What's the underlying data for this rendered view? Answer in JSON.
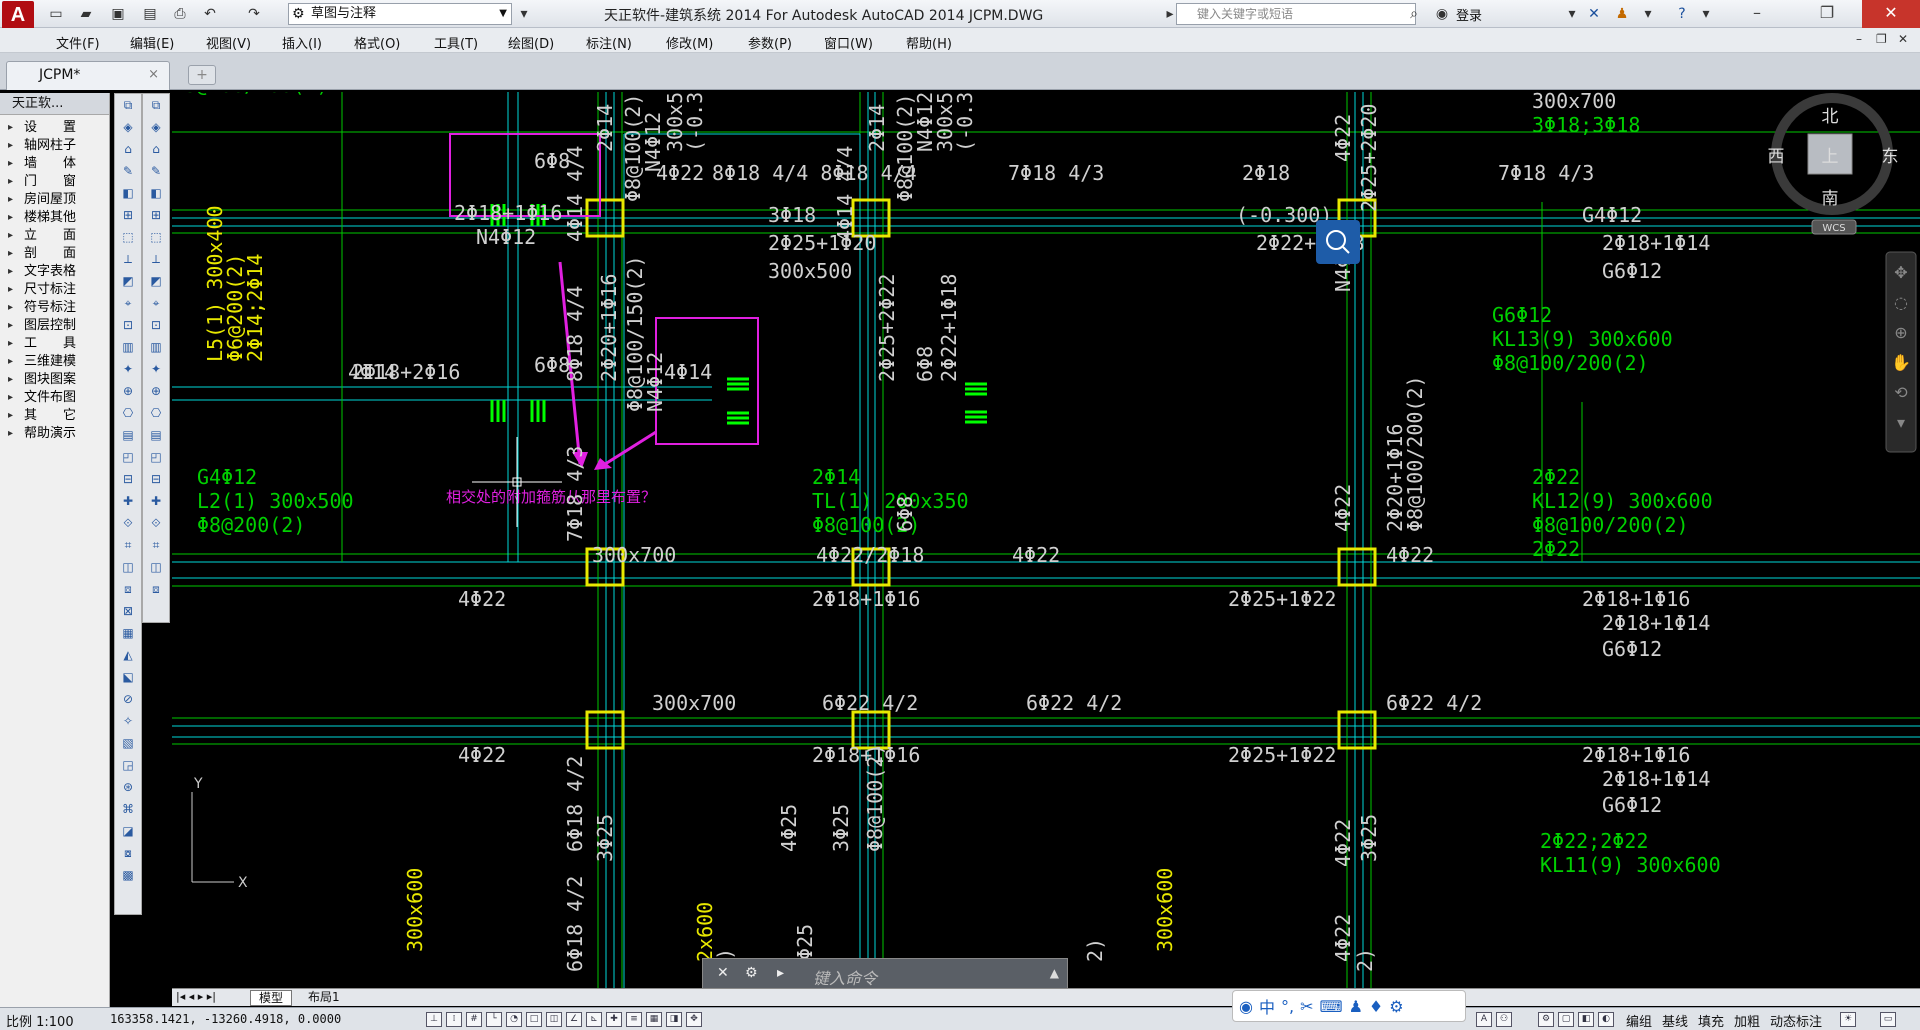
{
  "app": {
    "logo": "A",
    "title": "天正软件-建筑系统 2014  For Autodesk AutoCAD 2014    JCPM.DWG",
    "workspace": "草图与注释",
    "search_placeholder": "键入关键字或短语",
    "login": "登录"
  },
  "menu": [
    "文件(F)",
    "编辑(E)",
    "视图(V)",
    "插入(I)",
    "格式(O)",
    "工具(T)",
    "绘图(D)",
    "标注(N)",
    "修改(M)",
    "参数(P)",
    "窗口(W)",
    "帮助(H)"
  ],
  "tab": {
    "label": "JCPM*",
    "close": "×",
    "new": "+"
  },
  "panel": {
    "title": "天正软...",
    "items": [
      "设　　置",
      "轴网柱子",
      "墙　　体",
      "门　　窗",
      "房间屋顶",
      "楼梯其他",
      "立　　面",
      "剖　　面",
      "文字表格",
      "尺寸标注",
      "符号标注",
      "图层控制",
      "工　　具",
      "三维建模",
      "图块图案",
      "文件布图",
      "其　　它",
      "帮助演示"
    ]
  },
  "viewcube": {
    "north": "北",
    "south": "南",
    "east": "东",
    "west": "西",
    "top": "上",
    "wcs": "WCS"
  },
  "drawing": {
    "magenta_note": "相交处的附加箍筋从那里布置？",
    "ucs_x": "X",
    "ucs_y": "Y",
    "labels": [
      {
        "t": "6Φ8",
        "c": "w"
      },
      {
        "t": "2Φ18+1Φ16",
        "c": "w"
      },
      {
        "t": "N4Φ12",
        "c": "w"
      },
      {
        "t": "6Φ8",
        "c": "w"
      },
      {
        "t": "4Φ14",
        "c": "w"
      },
      {
        "t": "2Φ18+2Φ16",
        "c": "w"
      },
      {
        "t": "4Φ14",
        "c": "w"
      },
      {
        "t": "4Φ22",
        "c": "w"
      },
      {
        "t": "8Φ18  4/4  8Φ18  4/4",
        "c": "w"
      },
      {
        "t": "7Φ18  4/3",
        "c": "w"
      },
      {
        "t": "2Φ18",
        "c": "w"
      },
      {
        "t": "7Φ18  4/3",
        "c": "w"
      },
      {
        "t": "3Φ18",
        "c": "w"
      },
      {
        "t": "2Φ25+1Φ20",
        "c": "w"
      },
      {
        "t": "300x500",
        "c": "w"
      },
      {
        "t": "(-0.300)",
        "c": "w"
      },
      {
        "t": "2Φ22+1Φ18",
        "c": "w"
      },
      {
        "t": "G4Φ12",
        "c": "w"
      },
      {
        "t": "2Φ18+1Φ14",
        "c": "w"
      },
      {
        "t": "G6Φ12",
        "c": "w"
      },
      {
        "t": "300x700",
        "c": "w"
      },
      {
        "t": "4Φ22/2Φ18",
        "c": "w"
      },
      {
        "t": "4Φ22",
        "c": "w"
      },
      {
        "t": "4Φ22",
        "c": "w"
      },
      {
        "t": "4Φ22",
        "c": "w"
      },
      {
        "t": "2Φ18+1Φ16",
        "c": "w"
      },
      {
        "t": "2Φ25+1Φ22",
        "c": "w"
      },
      {
        "t": "2Φ18+1Φ16",
        "c": "w"
      },
      {
        "t": "2Φ18+1Φ14",
        "c": "w"
      },
      {
        "t": "G6Φ12",
        "c": "w"
      },
      {
        "t": "300x700",
        "c": "w"
      },
      {
        "t": "6Φ22  4/2",
        "c": "w"
      },
      {
        "t": "6Φ22  4/2",
        "c": "w"
      },
      {
        "t": "6Φ22  4/2",
        "c": "w"
      },
      {
        "t": "4Φ22",
        "c": "w"
      },
      {
        "t": "2Φ18+1Φ16",
        "c": "w"
      },
      {
        "t": "2Φ25+1Φ22",
        "c": "w"
      },
      {
        "t": "2Φ18+1Φ16",
        "c": "w"
      },
      {
        "t": "2Φ18+1Φ14",
        "c": "w"
      },
      {
        "t": "G6Φ12",
        "c": "w"
      },
      {
        "t": "300x700",
        "c": "w"
      },
      {
        "t": "3Φ18;3Φ18",
        "c": "g"
      },
      {
        "t": "G6Φ12",
        "c": "g"
      },
      {
        "t": "KL13(9) 300x600",
        "c": "g"
      },
      {
        "t": "Φ8@100/200(2)",
        "c": "g"
      },
      {
        "t": "2Φ22",
        "c": "g"
      },
      {
        "t": "KL12(9) 300x600",
        "c": "g"
      },
      {
        "t": "Φ8@100/200(2)",
        "c": "g"
      },
      {
        "t": "2Φ22",
        "c": "g"
      },
      {
        "t": "G4Φ12",
        "c": "g"
      },
      {
        "t": "L2(1) 300x500",
        "c": "g"
      },
      {
        "t": "Φ8@200(2)",
        "c": "g"
      },
      {
        "t": "2Φ14",
        "c": "g"
      },
      {
        "t": "TL(1) 200x350",
        "c": "g"
      },
      {
        "t": "Φ8@100(2)",
        "c": "g"
      },
      {
        "t": "2Φ22;2Φ22",
        "c": "g"
      },
      {
        "t": "KL11(9) 300x600",
        "c": "g"
      },
      {
        "t": "Φ8@100/200(2)",
        "c": "g"
      }
    ],
    "vlabels": [
      {
        "t": "4Φ14  4/4",
        "c": "w"
      },
      {
        "t": "2Φ14",
        "c": "w"
      },
      {
        "t": "Φ8@100(2)",
        "c": "w"
      },
      {
        "t": "N4Φ12",
        "c": "w"
      },
      {
        "t": "300x500",
        "c": "w"
      },
      {
        "t": "(-0.300)",
        "c": "w"
      },
      {
        "t": "4Φ14  4/4",
        "c": "w"
      },
      {
        "t": "2Φ14",
        "c": "w"
      },
      {
        "t": "Φ8@100(2)",
        "c": "w"
      },
      {
        "t": "N4Φ12",
        "c": "w"
      },
      {
        "t": "300x500",
        "c": "w"
      },
      {
        "t": "(-0.300)",
        "c": "w"
      },
      {
        "t": "4Φ22",
        "c": "w"
      },
      {
        "t": "2Φ25+2Φ20",
        "c": "w"
      },
      {
        "t": "8Φ18  4/4",
        "c": "w"
      },
      {
        "t": "2Φ20+1Φ16",
        "c": "w"
      },
      {
        "t": "Φ8@100/150(2)",
        "c": "w"
      },
      {
        "t": "N4Φ12",
        "c": "w"
      },
      {
        "t": "2Φ25+2Φ22",
        "c": "w"
      },
      {
        "t": "6Φ8",
        "c": "w"
      },
      {
        "t": "2Φ22+1Φ18",
        "c": "w"
      },
      {
        "t": "2Φ20+1Φ16",
        "c": "w"
      },
      {
        "t": "Φ8@100/200(2)",
        "c": "w"
      },
      {
        "t": "N4Φ12",
        "c": "w"
      },
      {
        "t": "6Φ8",
        "c": "w"
      },
      {
        "t": "7Φ18  4/3",
        "c": "w"
      },
      {
        "t": "4Φ22",
        "c": "w"
      },
      {
        "t": "6Φ18  4/2",
        "c": "w"
      },
      {
        "t": "3Φ25",
        "c": "w"
      },
      {
        "t": "4Φ25",
        "c": "w"
      },
      {
        "t": "3Φ25",
        "c": "w"
      },
      {
        "t": "Φ8@100(2)",
        "c": "w"
      },
      {
        "t": "4Φ22",
        "c": "w"
      },
      {
        "t": "3Φ25",
        "c": "w"
      },
      {
        "t": "6Φ18  4/2",
        "c": "w"
      },
      {
        "t": "4Φ25",
        "c": "w"
      },
      {
        "t": "4Φ22",
        "c": "w"
      },
      {
        "t": "L5(1) 300x400",
        "c": "y"
      },
      {
        "t": "Φ6@200(2)",
        "c": "y"
      },
      {
        "t": "2Φ14;2Φ14",
        "c": "y"
      },
      {
        "t": "300x600",
        "c": "y"
      },
      {
        "t": "2x600",
        "c": "y"
      },
      {
        "t": "300x600",
        "c": "y"
      },
      {
        "t": "2)",
        "c": "w"
      },
      {
        "t": "2)",
        "c": "w"
      },
      {
        "t": "2)",
        "c": "w"
      }
    ]
  },
  "command": {
    "placeholder": "键入命令"
  },
  "layouts": [
    "模型",
    "布局1"
  ],
  "status": {
    "scale": "比例 1:100",
    "coords": "163358.1421, -13260.4918, 0.0000",
    "right_buttons": [
      "编组",
      "基线",
      "填充",
      "加粗",
      "动态标注"
    ]
  },
  "ime": {
    "lang": "中"
  }
}
